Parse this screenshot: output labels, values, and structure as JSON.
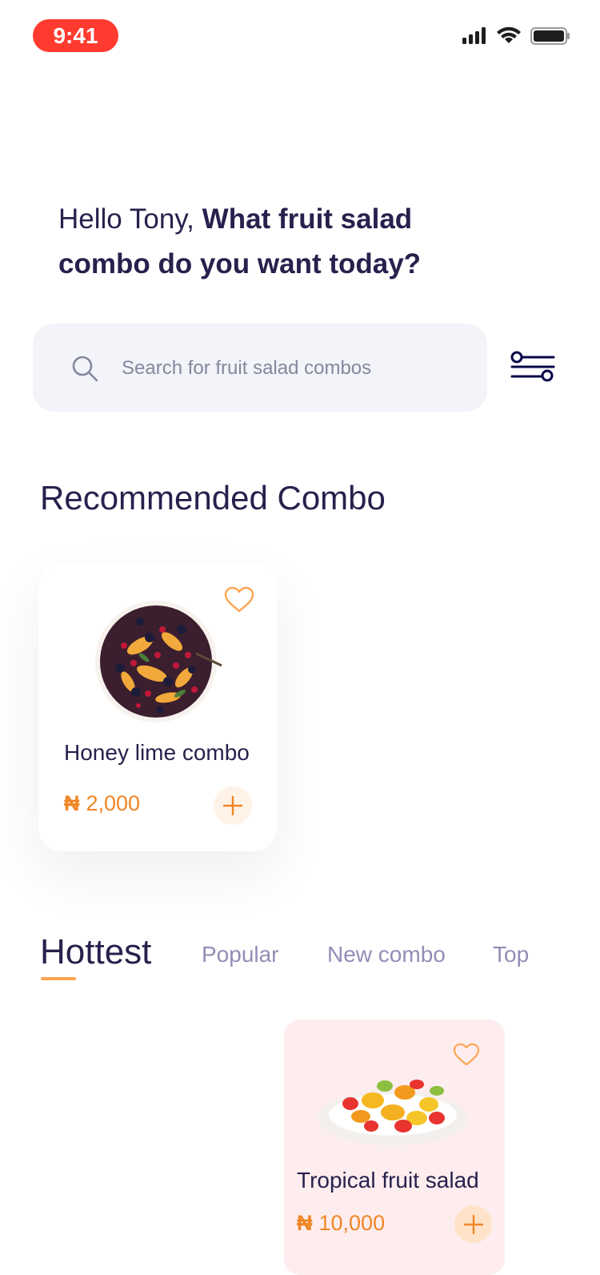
{
  "status_bar": {
    "time": "9:41",
    "icons": [
      "signal-icon",
      "wifi-icon",
      "battery-icon"
    ]
  },
  "greeting": {
    "hello": "Hello Tony,",
    "question": "What fruit salad combo do you want today?"
  },
  "search": {
    "placeholder": "Search for fruit salad combos"
  },
  "recommended": {
    "title": "Recommended Combo",
    "items": [
      {
        "name": "Honey lime combo",
        "currency": "₦",
        "price": "2,000"
      }
    ]
  },
  "tabs": [
    {
      "label": "Hottest",
      "active": true
    },
    {
      "label": "Popular",
      "active": false
    },
    {
      "label": "New combo",
      "active": false
    },
    {
      "label": "Top",
      "active": false
    }
  ],
  "hottest": {
    "items": [
      {
        "name": "Tropical fruit salad",
        "currency": "₦",
        "price": "10,000"
      }
    ]
  },
  "colors": {
    "primary_text": "#27214D",
    "accent": "#F08626",
    "accent_light": "#FFA451",
    "search_bg": "#F3F4F9",
    "status_pill": "#FF3B30",
    "hot_card_bg": "#FDEDEE"
  }
}
